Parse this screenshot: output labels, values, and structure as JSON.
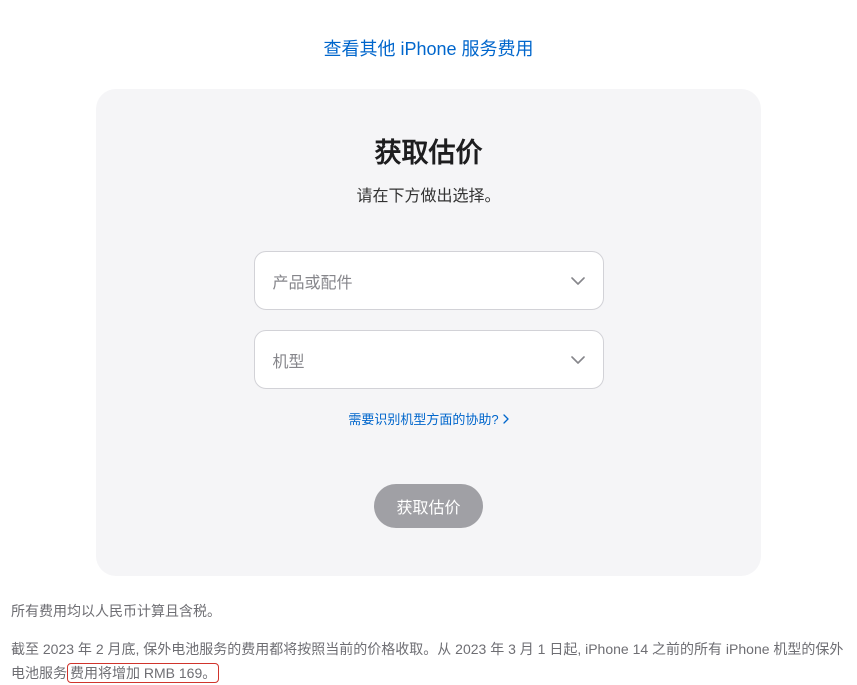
{
  "topLink": {
    "label": "查看其他 iPhone 服务费用"
  },
  "card": {
    "title": "获取估价",
    "subtitle": "请在下方做出选择。",
    "selects": {
      "product": {
        "placeholder": "产品或配件"
      },
      "model": {
        "placeholder": "机型"
      }
    },
    "helpLink": {
      "label": "需要识别机型方面的协助?"
    },
    "submit": {
      "label": "获取估价"
    }
  },
  "footer": {
    "line1": "所有费用均以人民币计算且含税。",
    "line2_part1": "截至 2023 年 2 月底, 保外电池服务的费用都将按照当前的价格收取。从 2023 年 3 月 1 日起, iPhone 14 之前的所有 iPhone 机型的保外电池服务",
    "line2_highlight": "费用将增加 RMB 169。"
  }
}
